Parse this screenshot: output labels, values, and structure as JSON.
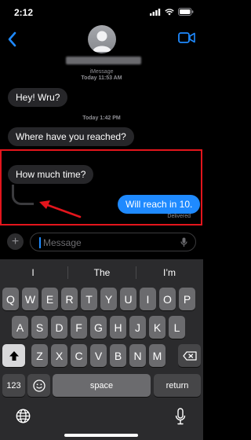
{
  "status": {
    "time": "2:12"
  },
  "conversation": {
    "service_label": "iMessage",
    "timestamp_1": "Today 11:53 AM",
    "timestamp_2": "Today 1:42 PM",
    "messages": [
      {
        "text": "Hey! Wru?",
        "direction": "incoming"
      },
      {
        "text": "Where have you reached?",
        "direction": "incoming"
      },
      {
        "text": "How much time?",
        "direction": "incoming"
      },
      {
        "text": "Will reach in 10.",
        "direction": "outgoing"
      }
    ],
    "delivery_status": "Delivered"
  },
  "composer": {
    "placeholder": "Message"
  },
  "keyboard": {
    "suggestions": [
      "I",
      "The",
      "I’m"
    ],
    "row1": [
      "Q",
      "W",
      "E",
      "R",
      "T",
      "Y",
      "U",
      "I",
      "O",
      "P"
    ],
    "row2": [
      "A",
      "S",
      "D",
      "F",
      "G",
      "H",
      "J",
      "K",
      "L"
    ],
    "row3": [
      "Z",
      "X",
      "C",
      "V",
      "B",
      "N",
      "M"
    ],
    "numbers_key": "123",
    "space_key": "space",
    "return_key": "return"
  },
  "colors": {
    "bubble_out": "#1f8aff",
    "bubble_in": "#262629",
    "annotation": "#e3151c"
  }
}
